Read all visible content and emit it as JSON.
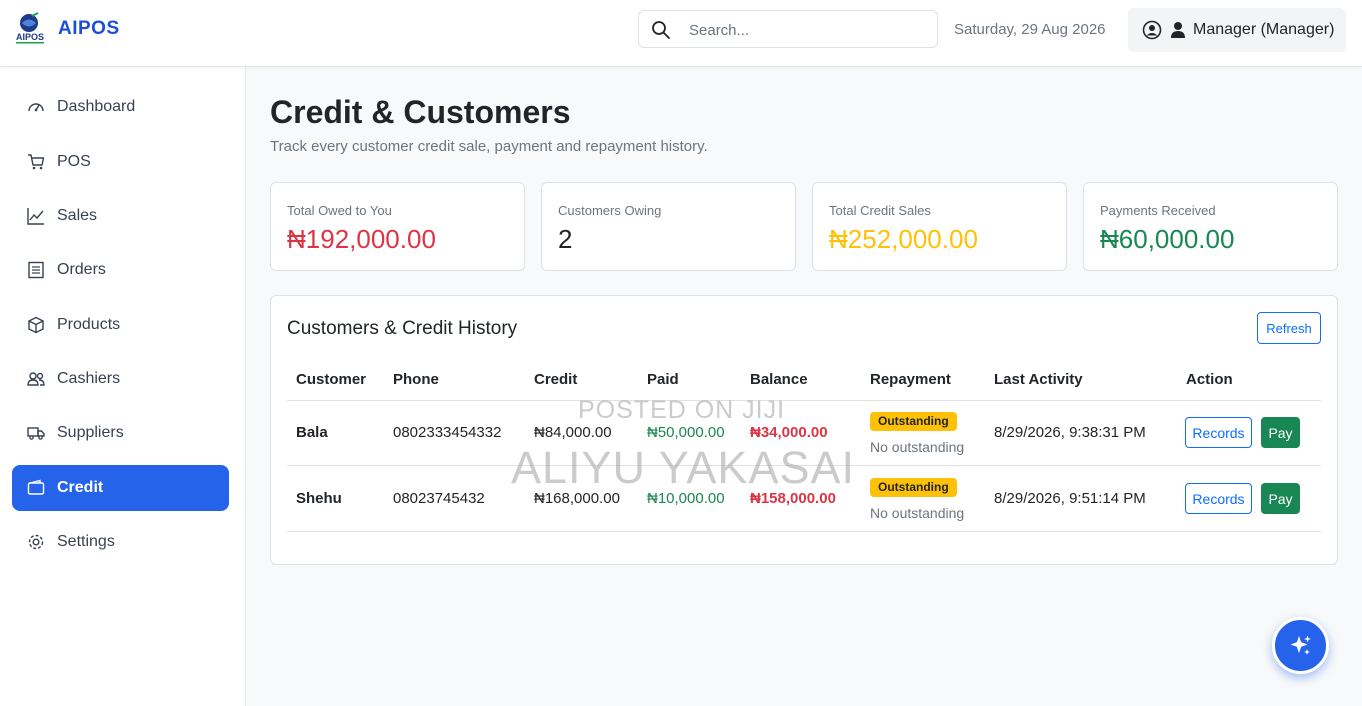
{
  "header": {
    "logo_text": "AIPOS",
    "brand": "AIPOS",
    "search_placeholder": "Search...",
    "date": "Saturday, 29 Aug 2026",
    "user": "Manager (Manager)"
  },
  "sidebar": {
    "items": [
      {
        "label": "Dashboard",
        "icon": "gauge-icon"
      },
      {
        "label": "POS",
        "icon": "cart-icon"
      },
      {
        "label": "Sales",
        "icon": "line-chart-icon"
      },
      {
        "label": "Orders",
        "icon": "list-icon"
      },
      {
        "label": "Products",
        "icon": "box-icon"
      },
      {
        "label": "Cashiers",
        "icon": "people-icon"
      },
      {
        "label": "Suppliers",
        "icon": "truck-icon"
      },
      {
        "label": "Credit",
        "icon": "wallet-icon",
        "active": true
      },
      {
        "label": "Settings",
        "icon": "gear-icon"
      }
    ]
  },
  "page": {
    "title": "Credit & Customers",
    "subtitle": "Track every customer credit sale, payment and repayment history."
  },
  "stats": [
    {
      "label": "Total Owed to You",
      "value": "₦192,000.00",
      "color": "#dc3545"
    },
    {
      "label": "Customers Owing",
      "value": "2",
      "color": "#212529"
    },
    {
      "label": "Total Credit Sales",
      "value": "₦252,000.00",
      "color": "#ffc107"
    },
    {
      "label": "Payments Received",
      "value": "₦60,000.00",
      "color": "#198754"
    }
  ],
  "table": {
    "title": "Customers & Credit History",
    "refresh_label": "Refresh",
    "columns": [
      "Customer",
      "Phone",
      "Credit",
      "Paid",
      "Balance",
      "Repayment",
      "Last Activity",
      "Action"
    ],
    "rows": [
      {
        "customer": "Bala",
        "phone": "0802333454332",
        "credit": "₦84,000.00",
        "paid": "₦50,000.00",
        "balance": "₦34,000.00",
        "repayment_badge": "Outstanding",
        "repayment_note": "No outstanding",
        "last_activity": "8/29/2026, 9:38:31 PM",
        "records_label": "Records",
        "pay_label": "Pay"
      },
      {
        "customer": "Shehu",
        "phone": "08023745432",
        "credit": "₦168,000.00",
        "paid": "₦10,000.00",
        "balance": "₦158,000.00",
        "repayment_badge": "Outstanding",
        "repayment_note": "No outstanding",
        "last_activity": "8/29/2026, 9:51:14 PM",
        "records_label": "Records",
        "pay_label": "Pay"
      }
    ]
  },
  "watermark": {
    "line1": "POSTED ON JIJI",
    "line2": "ALIYU YAKASAI"
  },
  "colors": {
    "primary": "#2563eb",
    "brand": "#1d4ed8",
    "success": "#198754",
    "danger": "#dc3545",
    "warning": "#ffc107"
  }
}
